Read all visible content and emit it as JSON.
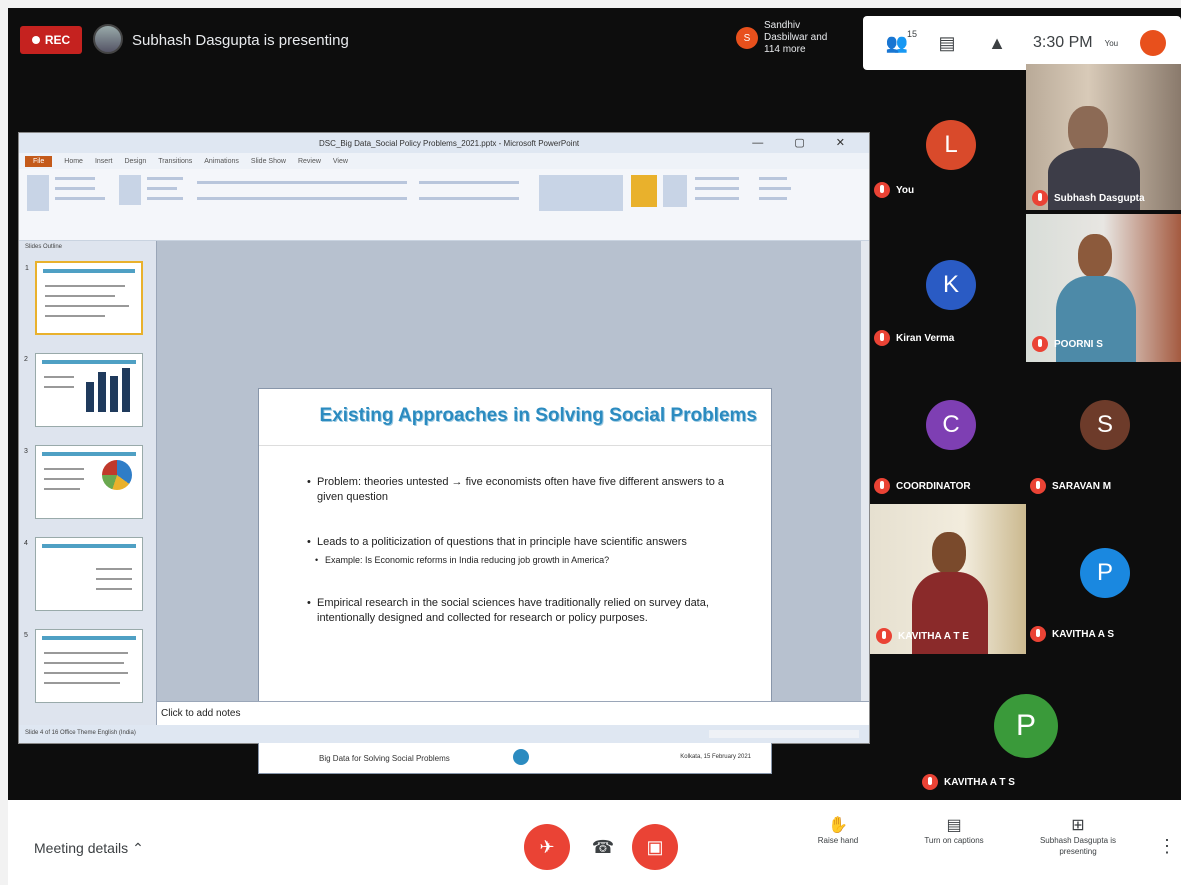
{
  "topbar": {
    "rec_label": "REC",
    "presenter_text": "Subhash Dasgupta is presenting",
    "viewers_badge": "S",
    "viewers_text": "Sandhiv Dasbilwar and 114 more",
    "people_count": "15",
    "time": "3:30 PM",
    "you_label": "You"
  },
  "powerpoint": {
    "window_title": "DSC_Big Data_Social Policy Problems_2021.pptx - Microsoft PowerPoint",
    "tabs": [
      "File",
      "Home",
      "Insert",
      "Design",
      "Transitions",
      "Animations",
      "Slide Show",
      "Review",
      "View"
    ],
    "panel_tabs": "Slides  Outline",
    "notes_placeholder": "Click to add notes",
    "status_text": "Slide 4 of 16   Office Theme   English (India)"
  },
  "slide": {
    "title": "Existing Approaches in Solving Social Problems",
    "bullet1": "Problem: theories untested → five economists often have five different answers to a given question",
    "bullet2": "Leads to a politicization of questions that in principle have scientific answers",
    "subbullet": "Example: Is Economic reforms in India reducing job growth in America?",
    "bullet3": "Empirical research in the social sciences have traditionally relied on survey data, intentionally designed and collected for research or policy purposes.",
    "footer_left": "Big Data for Solving Social Problems",
    "footer_right": "Kolkata, 15 February 2021"
  },
  "participants": [
    {
      "name": "You",
      "initial": "L",
      "color": "#d94a2b"
    },
    {
      "name": "Subhash Dasgupta",
      "initial": "",
      "color": ""
    },
    {
      "name": "Kiran Verma",
      "initial": "K",
      "color": "#2a5bc4"
    },
    {
      "name": "POORNI S",
      "initial": "",
      "color": ""
    },
    {
      "name": "COORDINATOR",
      "initial": "C",
      "color": "#7e3fb3"
    },
    {
      "name": "SARAVAN M",
      "initial": "S",
      "color": "#6d3b2a"
    },
    {
      "name": "KAVITHA A T E",
      "initial": "",
      "color": ""
    },
    {
      "name": "KAVITHA A S",
      "initial": "P",
      "color": "#1a88e0"
    },
    {
      "name": "KAVITHA A T S",
      "initial": "P",
      "color": "#3a9a3a"
    }
  ],
  "bottombar": {
    "meeting_details": "Meeting details",
    "raise_hand": "Raise hand",
    "captions": "Turn on captions",
    "presenting": "Subhash Dasgupta is presenting"
  }
}
